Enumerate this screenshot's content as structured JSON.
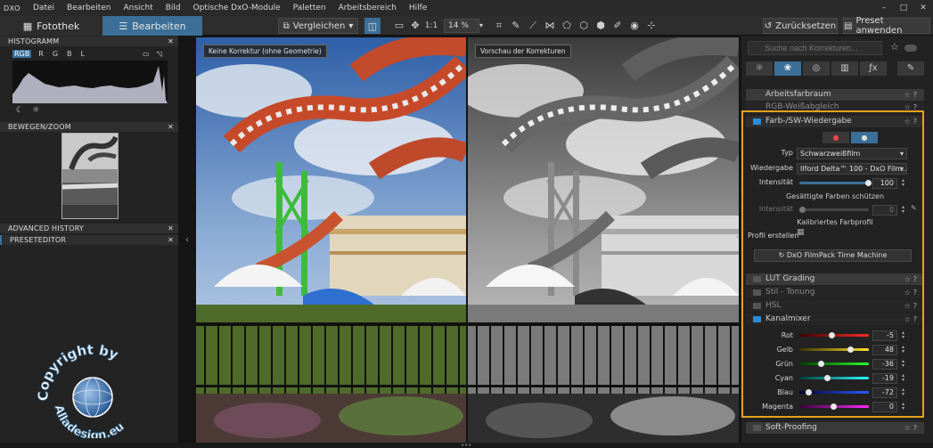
{
  "app": {
    "logo": "DXO"
  },
  "menu": [
    "Datei",
    "Bearbeiten",
    "Ansicht",
    "Bild",
    "Optische DxO-Module",
    "Paletten",
    "Arbeitsbereich",
    "Hilfe"
  ],
  "window": {
    "min": "–",
    "max": "□",
    "close": "✕"
  },
  "toolbar": {
    "library_tab": "Fotothek",
    "edit_tab": "Bearbeiten",
    "compare": "Vergleichen",
    "zoom_11": "1:1",
    "zoom_level": "14 %",
    "reset": "Zurücksetzen",
    "preset_apply": "Preset anwenden"
  },
  "left": {
    "histogram_title": "HISTOGRAMM",
    "channels": [
      "RGB",
      "R",
      "G",
      "B",
      "L"
    ],
    "active_channel": "RGB",
    "move_zoom_title": "BEWEGEN/ZOOM",
    "history_title": "ADVANCED HISTORY",
    "preset_editor_title": "PRESETEDITOR",
    "close": "✕"
  },
  "viewer": {
    "left_label": "Keine Korrektur (ohne Geometrie)",
    "right_label": "Vorschau der Korrekturen"
  },
  "right": {
    "search_placeholder": "Suche nach Korrekturen...",
    "palettes": {
      "workspace": "Arbeitsfarbraum",
      "white_balance": "RGB-Weißabgleich",
      "color_bw": "Farb-/SW-Wiedergabe",
      "lut": "LUT Grading",
      "style_toning": "Stil - Tonung",
      "hsl": "HSL",
      "channel_mixer": "Kanalmixer",
      "soft_proof": "Soft-Proofing"
    },
    "bw": {
      "type_label": "Typ",
      "type_value": "Schwarzweißfilm",
      "rendering_label": "Wiedergabe",
      "rendering_value": "Ilford Delta™ 100 - DxO Film...",
      "intensity_label": "Intensität",
      "intensity_value": 100,
      "protect_saturated": "Gesättigte Farben schützen",
      "protect_intensity_label": "Intensität",
      "protect_intensity_value": 0,
      "calibrated_profile": "Kalibriertes Farbprofil",
      "create_profile": "Profil erstellen",
      "filmpack_button": "DxO FilmPack Time Machine"
    },
    "mixer": [
      {
        "label": "Rot",
        "value": -5
      },
      {
        "label": "Gelb",
        "value": 48
      },
      {
        "label": "Grün",
        "value": -36
      },
      {
        "label": "Cyan",
        "value": -19
      },
      {
        "label": "Blau",
        "value": -72
      },
      {
        "label": "Magenta",
        "value": 0
      }
    ]
  },
  "watermark": {
    "text_top": "Copyright by",
    "text_bottom": "Alladesign.eu"
  }
}
